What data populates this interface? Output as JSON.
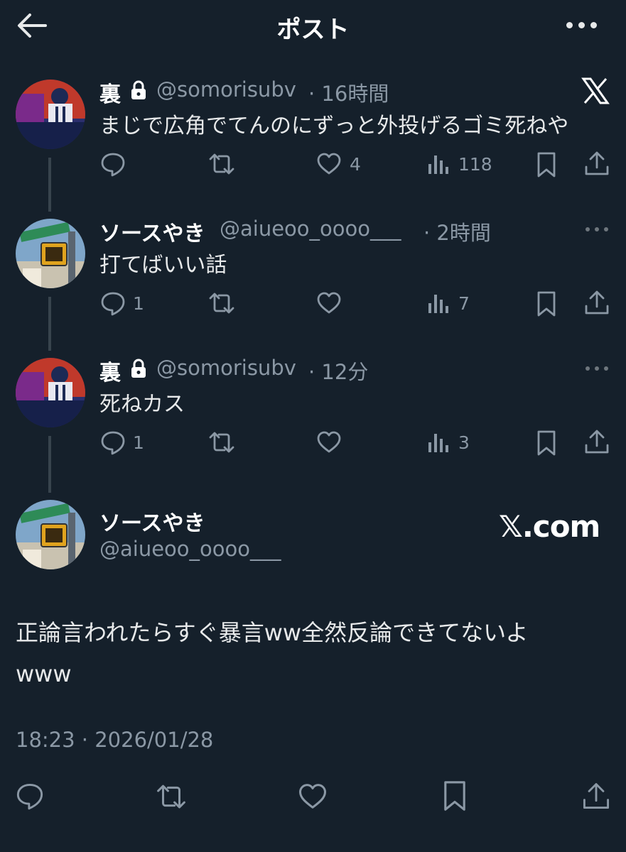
{
  "header": {
    "title": "ポスト"
  },
  "replies": [
    {
      "name": "裏",
      "handle": "@somorisubv",
      "time": "· 16時間",
      "text": "まじで広角でてんのにずっと外投げるゴミ死ねや",
      "replies": "",
      "retweets": "",
      "likes": "4",
      "views": "118"
    },
    {
      "name": "ソースやき",
      "handle": "@aiueoo_oooo___",
      "time": "· 2時間",
      "text": "打てばいい話",
      "replies": "1",
      "retweets": "",
      "likes": "",
      "views": "7"
    },
    {
      "name": "裏",
      "handle": "@somorisubv",
      "time": "· 12分",
      "text": "死ねカス",
      "replies": "1",
      "retweets": "",
      "likes": "",
      "views": "3"
    }
  ],
  "main_post": {
    "name": "ソースやき",
    "handle": "@aiueoo_oooo___",
    "text_line1": "正論言われたらすぐ暴言ww全然反論できてないよ",
    "text_line2": "www",
    "timestamp": "18:23 · 2026/01/28"
  },
  "watermark": {
    "x_logo": "𝕏",
    "site": "𝕏.com"
  },
  "colors": {
    "background": "#15202b",
    "text": "#e7e9ea",
    "secondary": "#8b98a5"
  }
}
